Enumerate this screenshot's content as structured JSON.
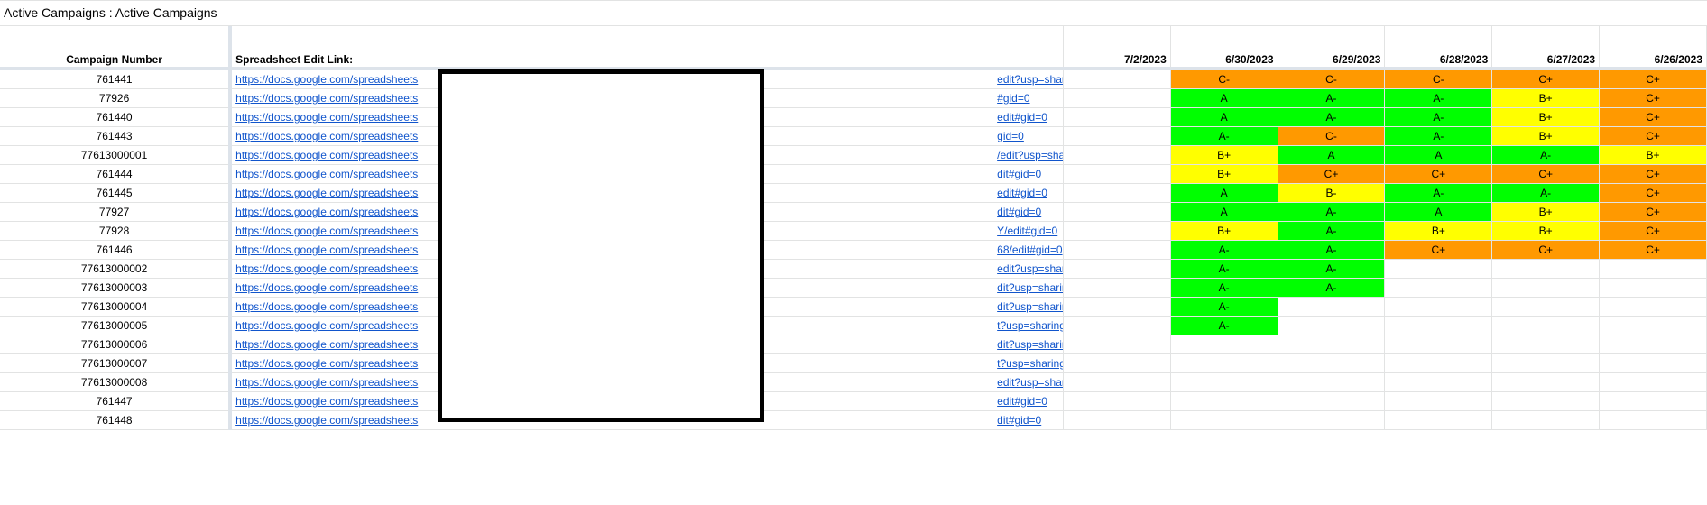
{
  "sheet_title": "Active Campaigns : Active Campaigns",
  "headers": {
    "campaign": "Campaign Number",
    "link": "Spreadsheet Edit Link:",
    "dates": [
      "7/2/2023",
      "6/30/2023",
      "6/29/2023",
      "6/28/2023",
      "6/27/2023",
      "6/26/2023"
    ]
  },
  "rows": [
    {
      "campaign": "761441",
      "link_start": "https://docs.google.com/spreadsheets",
      "link_end": "edit?usp=sharing",
      "grades": [
        "",
        "C-",
        "C-",
        "C-",
        "C+",
        "C+"
      ]
    },
    {
      "campaign": "77926",
      "link_start": "https://docs.google.com/spreadsheets",
      "link_end": "#gid=0",
      "grades": [
        "",
        "A",
        "A-",
        "A-",
        "B+",
        "C+"
      ]
    },
    {
      "campaign": "761440",
      "link_start": "https://docs.google.com/spreadsheets",
      "link_end": "edit#gid=0",
      "grades": [
        "",
        "A",
        "A-",
        "A-",
        "B+",
        "C+"
      ]
    },
    {
      "campaign": "761443",
      "link_start": "https://docs.google.com/spreadsheets",
      "link_end": "gid=0",
      "grades": [
        "",
        "A-",
        "C-",
        "A-",
        "B+",
        "C+"
      ]
    },
    {
      "campaign": "77613000001",
      "link_start": "https://docs.google.com/spreadsheets",
      "link_end": "/edit?usp=sharing",
      "grades": [
        "",
        "B+",
        "A",
        "A",
        "A-",
        "B+"
      ]
    },
    {
      "campaign": "761444",
      "link_start": "https://docs.google.com/spreadsheets",
      "link_end": "dit#gid=0",
      "grades": [
        "",
        "B+",
        "C+",
        "C+",
        "C+",
        "C+"
      ]
    },
    {
      "campaign": "761445",
      "link_start": "https://docs.google.com/spreadsheets",
      "link_end": "edit#gid=0",
      "grades": [
        "",
        "A",
        "B-",
        "A-",
        "A-",
        "C+"
      ]
    },
    {
      "campaign": "77927",
      "link_start": "https://docs.google.com/spreadsheets",
      "link_end": "dit#gid=0",
      "grades": [
        "",
        "A",
        "A-",
        "A",
        "B+",
        "C+"
      ]
    },
    {
      "campaign": "77928",
      "link_start": "https://docs.google.com/spreadsheets",
      "link_end": "Y/edit#gid=0",
      "grades": [
        "",
        "B+",
        "A-",
        "B+",
        "B+",
        "C+"
      ]
    },
    {
      "campaign": "761446",
      "link_start": "https://docs.google.com/spreadsheets",
      "link_end": "68/edit#gid=0",
      "grades": [
        "",
        "A-",
        "A-",
        "C+",
        "C+",
        "C+"
      ]
    },
    {
      "campaign": "77613000002",
      "link_start": "https://docs.google.com/spreadsheets",
      "link_end": "edit?usp=sharing",
      "grades": [
        "",
        "A-",
        "A-",
        "",
        "",
        ""
      ]
    },
    {
      "campaign": "77613000003",
      "link_start": "https://docs.google.com/spreadsheets",
      "link_end": "dit?usp=sharing",
      "grades": [
        "",
        "A-",
        "A-",
        "",
        "",
        ""
      ]
    },
    {
      "campaign": "77613000004",
      "link_start": "https://docs.google.com/spreadsheets",
      "link_end": "dit?usp=sharing",
      "grades": [
        "",
        "A-",
        "",
        "",
        "",
        ""
      ]
    },
    {
      "campaign": "77613000005",
      "link_start": "https://docs.google.com/spreadsheets",
      "link_end": "t?usp=sharing",
      "grades": [
        "",
        "A-",
        "",
        "",
        "",
        ""
      ]
    },
    {
      "campaign": "77613000006",
      "link_start": "https://docs.google.com/spreadsheets",
      "link_end": "dit?usp=sharing",
      "grades": [
        "",
        "",
        "",
        "",
        "",
        ""
      ]
    },
    {
      "campaign": "77613000007",
      "link_start": "https://docs.google.com/spreadsheets",
      "link_end": "t?usp=sharing",
      "grades": [
        "",
        "",
        "",
        "",
        "",
        ""
      ]
    },
    {
      "campaign": "77613000008",
      "link_start": "https://docs.google.com/spreadsheets",
      "link_end": "edit?usp=sharing",
      "grades": [
        "",
        "",
        "",
        "",
        "",
        ""
      ]
    },
    {
      "campaign": "761447",
      "link_start": "https://docs.google.com/spreadsheets",
      "link_end": "edit#gid=0",
      "grades": [
        "",
        "",
        "",
        "",
        "",
        ""
      ]
    },
    {
      "campaign": "761448",
      "link_start": "https://docs.google.com/spreadsheets",
      "link_end": "dit#gid=0",
      "grades": [
        "",
        "",
        "",
        "",
        "",
        ""
      ]
    }
  ],
  "grade_colors": {
    "A": "#00ff00",
    "A-": "#00ff00",
    "B+": "#ffff00",
    "B-": "#ffff00",
    "C+": "#ff9900",
    "C-": "#ff9900"
  }
}
